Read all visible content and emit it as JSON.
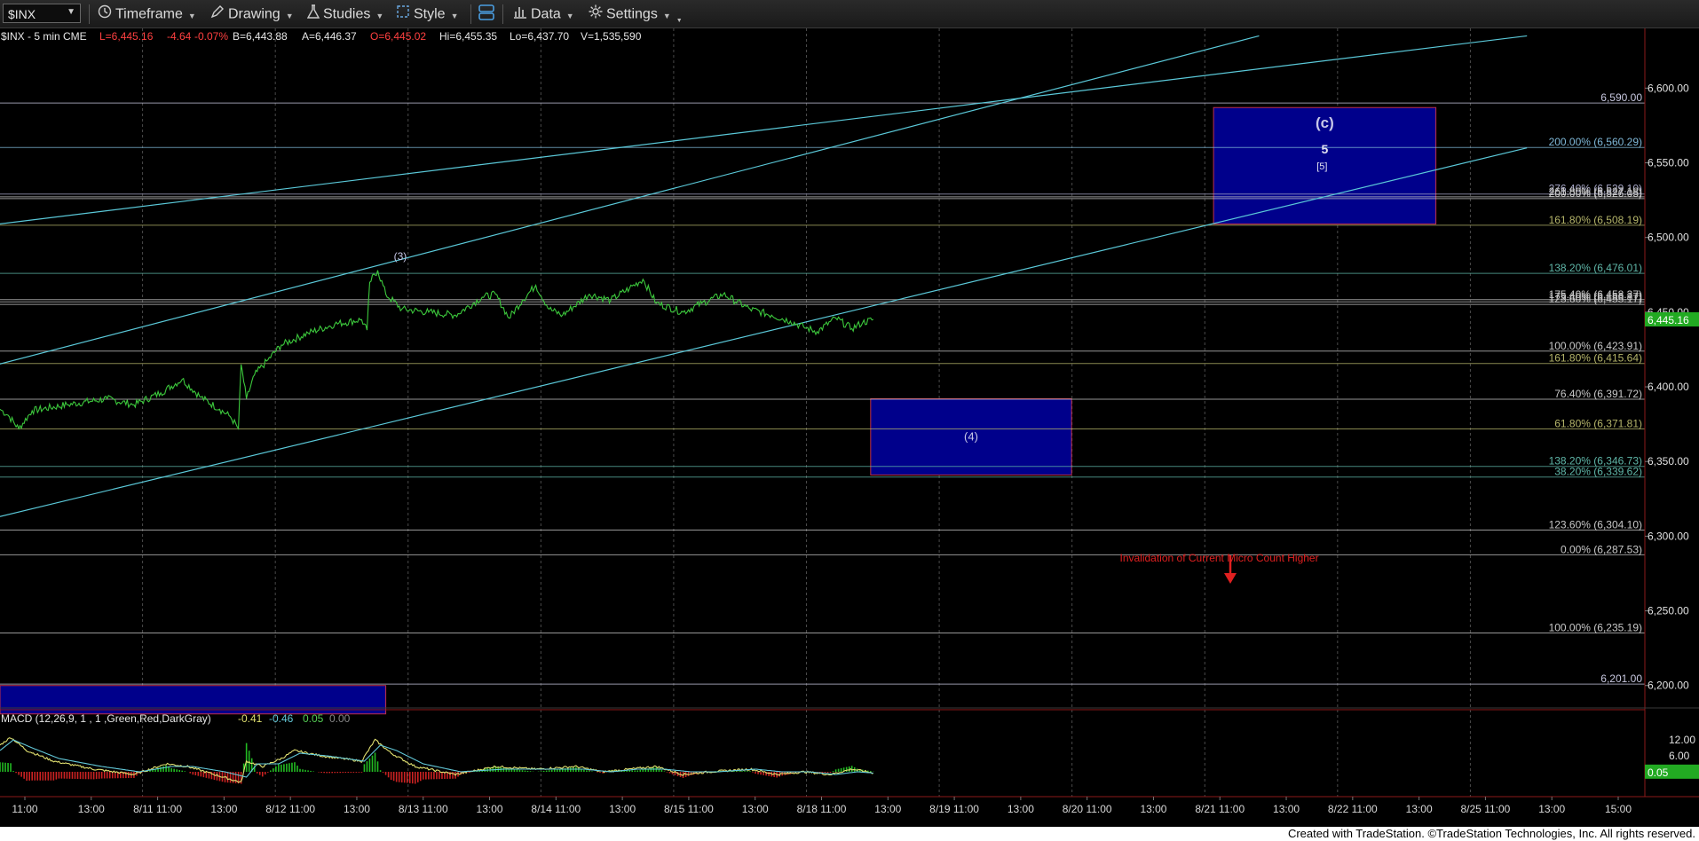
{
  "toolbar": {
    "symbol": "$INX",
    "timeframe": "Timeframe",
    "drawing": "Drawing",
    "studies": "Studies",
    "style": "Style",
    "data": "Data",
    "settings": "Settings"
  },
  "header": {
    "symbol_line": "$INX - 5 min  CME",
    "last": "L=6,445.16",
    "change": "-4.64",
    "change_pct": "-0.07%",
    "bid": "B=6,443.88",
    "ask": "A=6,446.37",
    "open": "O=6,445.02",
    "high": "Hi=6,455.35",
    "low": "Lo=6,437.70",
    "volume": "V=1,535,590"
  },
  "chart_data": [
    {
      "type": "line",
      "title": "$INX - 5 min",
      "price_axis": {
        "range": [
          6185,
          6640
        ],
        "ticks": [
          "6,600.00",
          "6,550.00",
          "6,500.00",
          "6,450.00",
          "6,400.00",
          "6,350.00",
          "6,300.00",
          "6,250.00",
          "6,200.00"
        ],
        "tick_values": [
          6600,
          6550,
          6500,
          6450,
          6400,
          6350,
          6300,
          6250,
          6200
        ],
        "last_price_label": "6,445.16"
      },
      "x_axis": {
        "ticks": [
          "11:00",
          "13:00",
          "8/11 11:00",
          "13:00",
          "8/12 11:00",
          "13:00",
          "8/13 11:00",
          "13:00",
          "8/14 11:00",
          "13:00",
          "8/15 11:00",
          "13:00",
          "8/18 11:00",
          "13:00",
          "8/19 11:00",
          "13:00",
          "8/20 11:00",
          "13:00",
          "8/21 11:00",
          "13:00",
          "8/22 11:00",
          "13:00",
          "8/25 11:00",
          "13:00",
          "15:00"
        ]
      },
      "price_series_anchors": [
        {
          "t": 0,
          "v": 6385
        },
        {
          "t": 3,
          "v": 6381
        },
        {
          "t": 7,
          "v": 6372
        },
        {
          "t": 12,
          "v": 6384
        },
        {
          "t": 25,
          "v": 6388
        },
        {
          "t": 40,
          "v": 6392
        },
        {
          "t": 50,
          "v": 6388
        },
        {
          "t": 60,
          "v": 6396
        },
        {
          "t": 68,
          "v": 6405
        },
        {
          "t": 75,
          "v": 6393
        },
        {
          "t": 82,
          "v": 6385
        },
        {
          "t": 86,
          "v": 6380
        },
        {
          "t": 89,
          "v": 6372
        },
        {
          "t": 90,
          "v": 6415
        },
        {
          "t": 92,
          "v": 6392
        },
        {
          "t": 95,
          "v": 6408
        },
        {
          "t": 100,
          "v": 6418
        },
        {
          "t": 105,
          "v": 6428
        },
        {
          "t": 115,
          "v": 6436
        },
        {
          "t": 125,
          "v": 6442
        },
        {
          "t": 135,
          "v": 6445
        },
        {
          "t": 137,
          "v": 6438
        },
        {
          "t": 138,
          "v": 6470
        },
        {
          "t": 141,
          "v": 6478
        },
        {
          "t": 144,
          "v": 6462
        },
        {
          "t": 150,
          "v": 6452
        },
        {
          "t": 160,
          "v": 6450
        },
        {
          "t": 170,
          "v": 6448
        },
        {
          "t": 180,
          "v": 6460
        },
        {
          "t": 185,
          "v": 6462
        },
        {
          "t": 190,
          "v": 6446
        },
        {
          "t": 195,
          "v": 6458
        },
        {
          "t": 200,
          "v": 6468
        },
        {
          "t": 205,
          "v": 6452
        },
        {
          "t": 210,
          "v": 6448
        },
        {
          "t": 220,
          "v": 6462
        },
        {
          "t": 228,
          "v": 6458
        },
        {
          "t": 235,
          "v": 6466
        },
        {
          "t": 240,
          "v": 6472
        },
        {
          "t": 245,
          "v": 6456
        },
        {
          "t": 255,
          "v": 6450
        },
        {
          "t": 262,
          "v": 6456
        },
        {
          "t": 270,
          "v": 6462
        },
        {
          "t": 280,
          "v": 6452
        },
        {
          "t": 288,
          "v": 6448
        },
        {
          "t": 295,
          "v": 6444
        },
        {
          "t": 300,
          "v": 6440
        },
        {
          "t": 305,
          "v": 6437
        },
        {
          "t": 312,
          "v": 6446
        },
        {
          "t": 318,
          "v": 6439
        },
        {
          "t": 322,
          "v": 6443
        },
        {
          "t": 326,
          "v": 6445.16
        }
      ],
      "horizontal_levels": [
        {
          "label": "6,590.00",
          "value": 6590,
          "color": "#c8c8e0"
        },
        {
          "label": "200.00% (6,560.29)",
          "value": 6560.29,
          "color": "#7fb8d8"
        },
        {
          "label": "276.40% (6,529.10)",
          "value": 6529.1,
          "color": "#a8a8c8"
        },
        {
          "label": "261.80% (6,527.18)",
          "value": 6527.18,
          "color": "#c8c8c8"
        },
        {
          "label": "200.00% (6,526.05)",
          "value": 6526.05,
          "color": "#c8c8c8"
        },
        {
          "label": "161.80% (6,508.19)",
          "value": 6508.19,
          "color": "#b5b56a"
        },
        {
          "label": "138.20% (6,476.01)",
          "value": 6476.01,
          "color": "#5fb6a8"
        },
        {
          "label": "175.40% (6,458.37)",
          "value": 6458.37,
          "color": "#c8c8c8"
        },
        {
          "label": "175.40% (6,456.87)",
          "value": 6456.87,
          "color": "#c8c8c8"
        },
        {
          "label": "123.60% (6,455.17)",
          "value": 6455.17,
          "color": "#c8c8c8"
        },
        {
          "label": "100.00% (6,423.91)",
          "value": 6423.91,
          "color": "#c8c8c8"
        },
        {
          "label": "161.80% (6,415.64)",
          "value": 6415.64,
          "color": "#b5b56a"
        },
        {
          "label": "76.40% (6,391.72)",
          "value": 6391.72,
          "color": "#c8c8c8"
        },
        {
          "label": "61.80% (6,371.81)",
          "value": 6371.81,
          "color": "#b5b56a"
        },
        {
          "label": "138.20% (6,346.73)",
          "value": 6346.73,
          "color": "#5fb6a8"
        },
        {
          "label": "38.20% (6,339.62)",
          "value": 6339.62,
          "color": "#5fb6a8"
        },
        {
          "label": "123.60% (6,304.10)",
          "value": 6304.1,
          "color": "#c8c8c8"
        },
        {
          "label": "0.00% (6,287.53)",
          "value": 6287.53,
          "color": "#c8c8c8"
        },
        {
          "label": "100.00% (6,235.19)",
          "value": 6235.19,
          "color": "#c8c8c8"
        },
        {
          "label": "6,201.00",
          "value": 6201,
          "color": "#c8c8e0"
        }
      ],
      "trendlines": [
        {
          "from": {
            "t": -5,
            "v": 6508
          },
          "to": {
            "t": 570,
            "v": 6635
          }
        },
        {
          "from": {
            "t": -5,
            "v": 6413
          },
          "to": {
            "t": 470,
            "v": 6635
          }
        },
        {
          "from": {
            "t": -5,
            "v": 6311
          },
          "to": {
            "t": 570,
            "v": 6560
          }
        }
      ],
      "boxes": [
        {
          "label": "(4)",
          "from": {
            "t": 325,
            "v": 6392
          },
          "to": {
            "t": 400,
            "v": 6341
          }
        },
        {
          "label": "(c)",
          "sublabels": [
            "5",
            "[5]"
          ],
          "from": {
            "t": 453,
            "v": 6587
          },
          "to": {
            "t": 536,
            "v": 6509
          }
        },
        {
          "label": "",
          "from": {
            "t": -5,
            "v": 6200
          },
          "to": {
            "t": 144,
            "v": 6181
          }
        }
      ],
      "annotations": [
        {
          "text": "(3)",
          "t": 147,
          "v": 6485
        },
        {
          "text": "Invalidation of Current Micro Count Higher",
          "t": 418,
          "v": 6283
        }
      ]
    },
    {
      "type": "line",
      "title": "MACD (12,26,9, 1 , 1 ,Green,Red,DarkGray)",
      "legend_values": [
        "-0.41",
        "-0.46",
        "0.05",
        "0.00"
      ],
      "axis": {
        "ticks": [
          "12.00",
          "6.00"
        ],
        "tick_values": [
          12,
          6
        ],
        "last_label": "0.05"
      },
      "series": [
        {
          "name": "MACD",
          "color": "#e0e070",
          "values": [
            [
              0,
              10
            ],
            [
              4,
              13
            ],
            [
              10,
              8
            ],
            [
              20,
              4
            ],
            [
              35,
              1
            ],
            [
              50,
              -1
            ],
            [
              62,
              3
            ],
            [
              70,
              2
            ],
            [
              80,
              -1
            ],
            [
              90,
              -4
            ],
            [
              92,
              4
            ],
            [
              98,
              2
            ],
            [
              105,
              5
            ],
            [
              110,
              8
            ],
            [
              120,
              6
            ],
            [
              135,
              4
            ],
            [
              140,
              12
            ],
            [
              146,
              7
            ],
            [
              155,
              2
            ],
            [
              170,
              -1
            ],
            [
              185,
              2
            ],
            [
              200,
              1
            ],
            [
              215,
              2
            ],
            [
              225,
              0
            ],
            [
              235,
              1
            ],
            [
              245,
              2
            ],
            [
              255,
              -1
            ],
            [
              265,
              0
            ],
            [
              280,
              1
            ],
            [
              290,
              -1
            ],
            [
              300,
              0
            ],
            [
              310,
              -1
            ],
            [
              318,
              1
            ],
            [
              326,
              -0.41
            ]
          ]
        },
        {
          "name": "Signal",
          "color": "#62c8d8",
          "values": [
            [
              0,
              8
            ],
            [
              5,
              12
            ],
            [
              12,
              9
            ],
            [
              22,
              5
            ],
            [
              38,
              2
            ],
            [
              52,
              0
            ],
            [
              64,
              2
            ],
            [
              72,
              2
            ],
            [
              84,
              0
            ],
            [
              92,
              -2
            ],
            [
              96,
              3
            ],
            [
              104,
              3
            ],
            [
              112,
              7
            ],
            [
              122,
              6
            ],
            [
              136,
              4
            ],
            [
              142,
              10
            ],
            [
              148,
              8
            ],
            [
              158,
              3
            ],
            [
              172,
              0
            ],
            [
              188,
              1
            ],
            [
              202,
              1
            ],
            [
              218,
              1
            ],
            [
              228,
              0
            ],
            [
              238,
              1
            ],
            [
              248,
              1
            ],
            [
              258,
              0
            ],
            [
              268,
              0
            ],
            [
              282,
              1
            ],
            [
              292,
              0
            ],
            [
              302,
              0
            ],
            [
              312,
              -1
            ],
            [
              320,
              0
            ],
            [
              326,
              -0.46
            ]
          ]
        }
      ]
    }
  ]
}
